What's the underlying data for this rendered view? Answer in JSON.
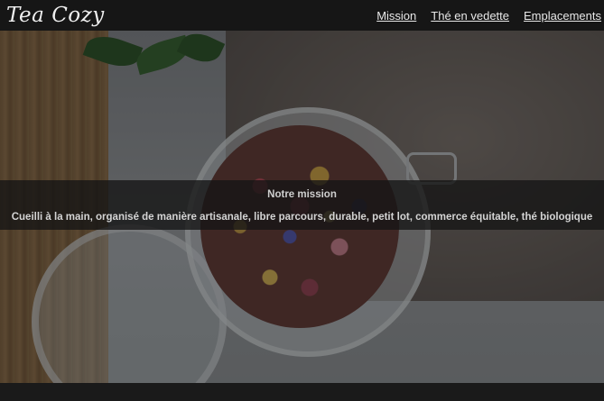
{
  "header": {
    "logo_text": "Tea Cozy",
    "nav": [
      {
        "label": "Mission"
      },
      {
        "label": "Thé en vedette"
      },
      {
        "label": "Emplacements"
      }
    ]
  },
  "hero": {
    "image_subject": "jar of loose-leaf flower tea on a table"
  },
  "mission": {
    "title": "Notre mission",
    "text": "Cueilli à la main, organisé de manière artisanale, libre parcours, durable, petit lot, commerce équitable, thé biologique"
  },
  "colors": {
    "header_bg": "#161616",
    "band_bg": "#141414",
    "text": "#e8e8e8"
  }
}
